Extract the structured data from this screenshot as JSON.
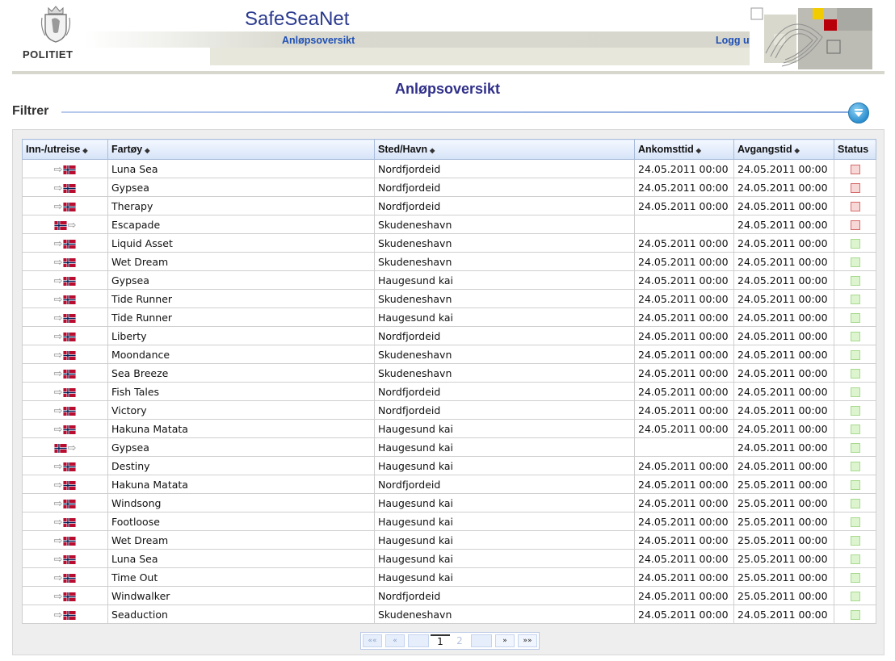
{
  "header": {
    "logo_text": "POLITIET",
    "app_title": "SafeSeaNet",
    "nav_link": "Anløpsoversikt",
    "logout_label": "Logg ut"
  },
  "page": {
    "title": "Anløpsoversikt",
    "filter_label": "Filtrer"
  },
  "table": {
    "headers": [
      "Inn-/utreise",
      "Fartøy",
      "Sted/Havn",
      "Ankomsttid",
      "Avgangstid",
      "Status"
    ],
    "rows": [
      {
        "direction": "inn",
        "vessel": "Luna Sea",
        "port": "Nordfjordeid",
        "arrival": "24.05.2011 00:00",
        "departure": "24.05.2011 00:00",
        "status": "red"
      },
      {
        "direction": "inn",
        "vessel": "Gypsea",
        "port": "Nordfjordeid",
        "arrival": "24.05.2011 00:00",
        "departure": "24.05.2011 00:00",
        "status": "red"
      },
      {
        "direction": "inn",
        "vessel": "Therapy",
        "port": "Nordfjordeid",
        "arrival": "24.05.2011 00:00",
        "departure": "24.05.2011 00:00",
        "status": "red"
      },
      {
        "direction": "ut",
        "vessel": "Escapade",
        "port": "Skudeneshavn",
        "arrival": "",
        "departure": "24.05.2011 00:00",
        "status": "red"
      },
      {
        "direction": "inn",
        "vessel": "Liquid Asset",
        "port": "Skudeneshavn",
        "arrival": "24.05.2011 00:00",
        "departure": "24.05.2011 00:00",
        "status": "green"
      },
      {
        "direction": "inn",
        "vessel": "Wet Dream",
        "port": "Skudeneshavn",
        "arrival": "24.05.2011 00:00",
        "departure": "24.05.2011 00:00",
        "status": "green"
      },
      {
        "direction": "inn",
        "vessel": "Gypsea",
        "port": "Haugesund kai",
        "arrival": "24.05.2011 00:00",
        "departure": "24.05.2011 00:00",
        "status": "green"
      },
      {
        "direction": "inn",
        "vessel": "Tide Runner",
        "port": "Skudeneshavn",
        "arrival": "24.05.2011 00:00",
        "departure": "24.05.2011 00:00",
        "status": "green"
      },
      {
        "direction": "inn",
        "vessel": "Tide Runner",
        "port": "Haugesund kai",
        "arrival": "24.05.2011 00:00",
        "departure": "24.05.2011 00:00",
        "status": "green"
      },
      {
        "direction": "inn",
        "vessel": "Liberty",
        "port": "Nordfjordeid",
        "arrival": "24.05.2011 00:00",
        "departure": "24.05.2011 00:00",
        "status": "green"
      },
      {
        "direction": "inn",
        "vessel": "Moondance",
        "port": "Skudeneshavn",
        "arrival": "24.05.2011 00:00",
        "departure": "24.05.2011 00:00",
        "status": "green"
      },
      {
        "direction": "inn",
        "vessel": "Sea Breeze",
        "port": "Skudeneshavn",
        "arrival": "24.05.2011 00:00",
        "departure": "24.05.2011 00:00",
        "status": "green"
      },
      {
        "direction": "inn",
        "vessel": "Fish Tales",
        "port": "Nordfjordeid",
        "arrival": "24.05.2011 00:00",
        "departure": "24.05.2011 00:00",
        "status": "green"
      },
      {
        "direction": "inn",
        "vessel": "Victory",
        "port": "Nordfjordeid",
        "arrival": "24.05.2011 00:00",
        "departure": "24.05.2011 00:00",
        "status": "green"
      },
      {
        "direction": "inn",
        "vessel": "Hakuna Matata",
        "port": "Haugesund kai",
        "arrival": "24.05.2011 00:00",
        "departure": "24.05.2011 00:00",
        "status": "green"
      },
      {
        "direction": "ut",
        "vessel": "Gypsea",
        "port": "Haugesund kai",
        "arrival": "",
        "departure": "24.05.2011 00:00",
        "status": "green"
      },
      {
        "direction": "inn",
        "vessel": "Destiny",
        "port": "Haugesund kai",
        "arrival": "24.05.2011 00:00",
        "departure": "24.05.2011 00:00",
        "status": "green"
      },
      {
        "direction": "inn",
        "vessel": "Hakuna Matata",
        "port": "Nordfjordeid",
        "arrival": "24.05.2011 00:00",
        "departure": "25.05.2011 00:00",
        "status": "green"
      },
      {
        "direction": "inn",
        "vessel": "Windsong",
        "port": "Haugesund kai",
        "arrival": "24.05.2011 00:00",
        "departure": "25.05.2011 00:00",
        "status": "green"
      },
      {
        "direction": "inn",
        "vessel": "Footloose",
        "port": "Haugesund kai",
        "arrival": "24.05.2011 00:00",
        "departure": "25.05.2011 00:00",
        "status": "green"
      },
      {
        "direction": "inn",
        "vessel": "Wet Dream",
        "port": "Haugesund kai",
        "arrival": "24.05.2011 00:00",
        "departure": "25.05.2011 00:00",
        "status": "green"
      },
      {
        "direction": "inn",
        "vessel": "Luna Sea",
        "port": "Haugesund kai",
        "arrival": "24.05.2011 00:00",
        "departure": "25.05.2011 00:00",
        "status": "green"
      },
      {
        "direction": "inn",
        "vessel": "Time Out",
        "port": "Haugesund kai",
        "arrival": "24.05.2011 00:00",
        "departure": "25.05.2011 00:00",
        "status": "green"
      },
      {
        "direction": "inn",
        "vessel": "Windwalker",
        "port": "Nordfjordeid",
        "arrival": "24.05.2011 00:00",
        "departure": "25.05.2011 00:00",
        "status": "green"
      },
      {
        "direction": "inn",
        "vessel": "Seaduction",
        "port": "Skudeneshavn",
        "arrival": "24.05.2011 00:00",
        "departure": "24.05.2011 00:00",
        "status": "green"
      }
    ]
  },
  "pager": {
    "first": "««",
    "prev": "«",
    "next": "»",
    "last": "»»",
    "pages": [
      "1",
      "2"
    ],
    "current_page": "1"
  },
  "colors": {
    "title_blue": "#2f2f8a",
    "link_blue": "#1f50b5",
    "status_red": "#d66a6a",
    "status_green": "#a8d98e"
  }
}
